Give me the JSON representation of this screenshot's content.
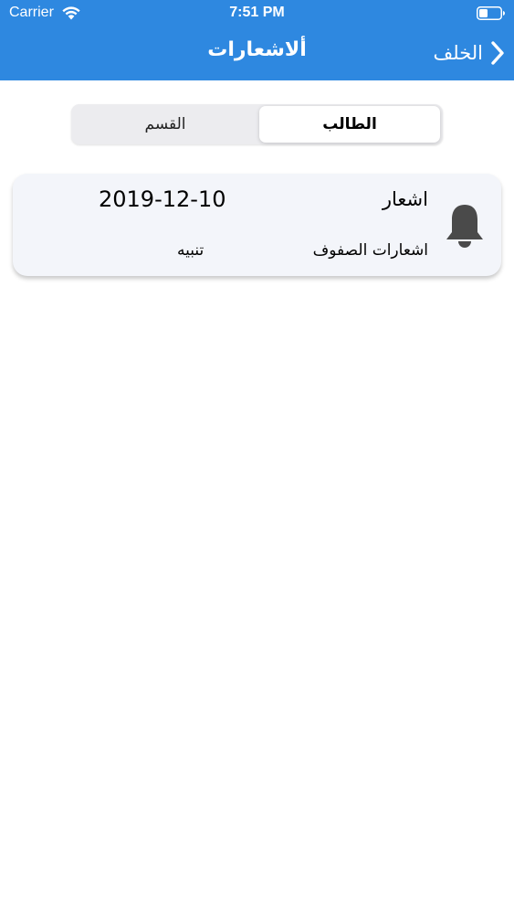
{
  "status_bar": {
    "carrier": "Carrier",
    "time": "7:51 PM"
  },
  "nav": {
    "title": "ألاشعارات",
    "back_label": "الخلف"
  },
  "segmented_control": {
    "options": [
      "القسم",
      "الطالب"
    ],
    "selected": "الطالب"
  },
  "notifications": [
    {
      "title": "اشعار",
      "date": "2019-12-10",
      "subtitle": "اشعارات الصفوف",
      "type": "تنبيه",
      "icon": "bell-icon"
    }
  ],
  "colors": {
    "header": "#2e88e0",
    "card_background": "#f3f5fa",
    "bell": "#4a4a4a"
  }
}
